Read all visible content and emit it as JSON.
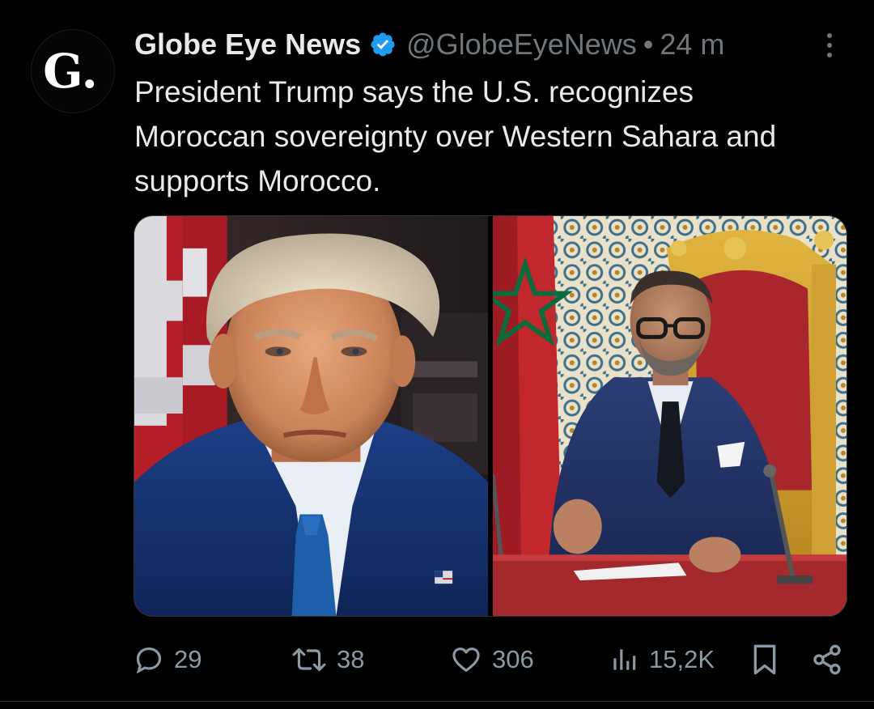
{
  "author": {
    "avatar_letter": "G.",
    "display_name": "Globe Eye News",
    "handle": "@GlobeEyeNews",
    "separator": "•",
    "time": "24 m",
    "verified": true,
    "verified_color": "#1d9bf0"
  },
  "tweet": {
    "text": "President Trump says the U.S. recognizes Moroccan sovereignty over Western Sahara and supports Morocco."
  },
  "media": {
    "images": [
      {
        "name": "trump-portrait-photo"
      },
      {
        "name": "king-mohammed-vi-photo"
      }
    ]
  },
  "actions": {
    "replies": "29",
    "reposts": "38",
    "likes": "306",
    "views": "15,2K"
  },
  "colors": {
    "background": "#000000",
    "text": "#e7e9ea",
    "secondary": "#71767b",
    "icon": "#8b98a5"
  }
}
